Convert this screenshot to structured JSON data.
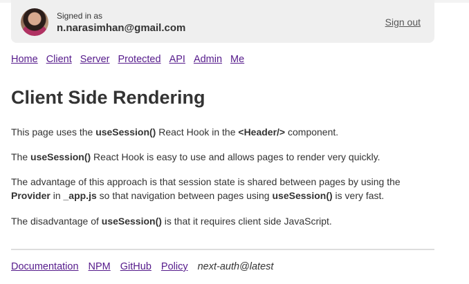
{
  "header": {
    "signed_in_label": "Signed in as",
    "email": "n.narasimhan@gmail.com",
    "sign_out": "Sign out"
  },
  "nav": [
    "Home",
    "Client",
    "Server",
    "Protected",
    "API",
    "Admin",
    "Me"
  ],
  "main": {
    "title": "Client Side Rendering",
    "p1": {
      "a": "This page uses the ",
      "b": "useSession()",
      "c": " React Hook in the ",
      "d": "<Header/>",
      "e": " component."
    },
    "p2": {
      "a": "The ",
      "b": "useSession()",
      "c": " React Hook is easy to use and allows pages to render very quickly."
    },
    "p3": {
      "a": "The advantage of this approach is that session state is shared between pages by using the ",
      "b": "Provider",
      "c": " in ",
      "d": "_app.js",
      "e": " so that navigation between pages using ",
      "f": "useSession()",
      "g": " is very fast."
    },
    "p4": {
      "a": "The disadvantage of ",
      "b": "useSession()",
      "c": " is that it requires client side JavaScript."
    }
  },
  "footer": {
    "links": [
      "Documentation",
      "NPM",
      "GitHub",
      "Policy"
    ],
    "version": "next-auth@latest"
  }
}
